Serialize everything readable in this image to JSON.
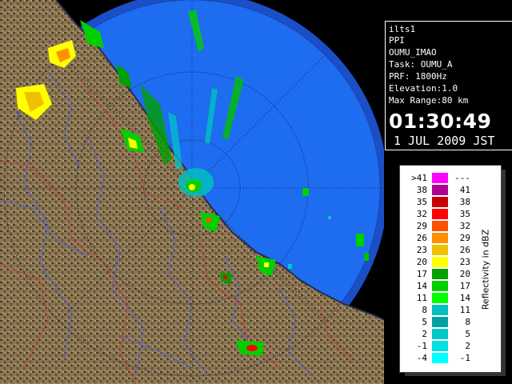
{
  "info": {
    "lines": [
      "ilts1",
      "PPI",
      "OUMU_IMAO",
      "Task: OUMU_A",
      "PRF: 1800Hz",
      "Elevation:1.0",
      "Max Range:80 km"
    ],
    "time": "01:30:49",
    "date": "1 JUL 2009 JST"
  },
  "legend": {
    "title": "Reflectivity in dBZ",
    "rows": [
      {
        "left": ">41",
        "right": "---",
        "color": "#ff00ff"
      },
      {
        "left": "38",
        "right": "41",
        "color": "#b00090"
      },
      {
        "left": "35",
        "right": "38",
        "color": "#c80000"
      },
      {
        "left": "32",
        "right": "35",
        "color": "#ff0000"
      },
      {
        "left": "29",
        "right": "32",
        "color": "#ff5000"
      },
      {
        "left": "26",
        "right": "29",
        "color": "#ff9000"
      },
      {
        "left": "23",
        "right": "26",
        "color": "#f0c000"
      },
      {
        "left": "20",
        "right": "23",
        "color": "#ffff00"
      },
      {
        "left": "17",
        "right": "20",
        "color": "#00a000"
      },
      {
        "left": "14",
        "right": "17",
        "color": "#00d000"
      },
      {
        "left": "11",
        "right": "14",
        "color": "#00ff00"
      },
      {
        "left": "8",
        "right": "11",
        "color": "#00c0c0"
      },
      {
        "left": "5",
        "right": "8",
        "color": "#00a0a0"
      },
      {
        "left": "2",
        "right": "5",
        "color": "#00c8c8"
      },
      {
        "left": "-1",
        "right": "2",
        "color": "#00e0e0"
      },
      {
        "left": "-4",
        "right": "-1",
        "color": "#00ffff"
      }
    ]
  },
  "colors": {
    "sea": "#1e6cf0",
    "sea_outer": "#1a4fc8",
    "land": "#7d6a4a",
    "land_dark": "#3e3020",
    "rivers": "#5060d0",
    "borders": "#c04040"
  }
}
